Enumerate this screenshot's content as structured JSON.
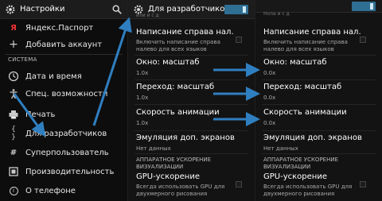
{
  "left": {
    "title": "Настройки",
    "items": [
      {
        "label": "Яндекс.Паспорт",
        "icon": "yandex-passport-icon"
      },
      {
        "label": "Добавить аккаунт",
        "icon": "plus-icon"
      },
      {
        "label": "Дата и время",
        "icon": "clock-icon"
      },
      {
        "label": "Спец. возможности",
        "icon": "accessibility-icon"
      },
      {
        "label": "Печать",
        "icon": "printer-icon"
      },
      {
        "label": "Для разработчиков",
        "icon": "code-braces-icon"
      },
      {
        "label": "Суперпользователь",
        "icon": "superuser-icon"
      },
      {
        "label": "Производительность",
        "icon": "performance-icon"
      },
      {
        "label": "О телефоне",
        "icon": "info-icon"
      }
    ],
    "section": "СИСТЕМА",
    "glyphs": {
      "plus": "+",
      "code": "{ }",
      "hash": "#",
      "info": "i"
    }
  },
  "dev": {
    "title": "Для разработчиков",
    "top_partial": "или и с д",
    "items": {
      "help_title": "Написание справа нал.",
      "help_sub1": "Включить написание справа",
      "help_sub2": "налево для всех языков",
      "window_title": "Окно: масштаб",
      "window_value": "1.0x",
      "transition_title": "Переход: масштаб",
      "transition_value": "1.0x",
      "animation_title": "Скорость анимации",
      "animation_value": "1.0x",
      "emulation_title": "Эмуляция доп. экранов",
      "emulation_sub": "Нет данных",
      "hw_section1": "АППАРАТНОЕ УСКОРЕНИЕ",
      "hw_section2": "ВИЗУАЛИЗАЦИИ",
      "gpu_title": "GPU-ускорение",
      "gpu_sub1": "Всегда использовать GPU для",
      "gpu_sub2": "двухмерного рисования"
    }
  },
  "dev2": {
    "top_partial": "Нола и с д",
    "items": {
      "help_title": "Написание справа нал.",
      "help_sub1": "Включить написание справа",
      "help_sub2": "налево для всех языков",
      "window_title": "Окно: масштаб",
      "window_value": "0.0x",
      "transition_title": "Переход: масштаб",
      "transition_value": "0.0x",
      "animation_title": "Скорость анимации",
      "animation_value": "0.0x",
      "emulation_title": "Эмуляция доп. экранов",
      "emulation_sub": "Нет данных",
      "hw_section1": "АППАРАТНОЕ УСКОРЕНИЕ",
      "hw_section2": "ВИЗУАЛИЗАЦИИ",
      "gpu_title": "GPU-ускорение",
      "gpu_sub1": "Всегда использовать GPU для",
      "gpu_sub2": "двухмерного рисования"
    }
  },
  "colors": {
    "accent": "#2e6f93",
    "arrow": "#2f7fc0",
    "bg": "#131313"
  }
}
